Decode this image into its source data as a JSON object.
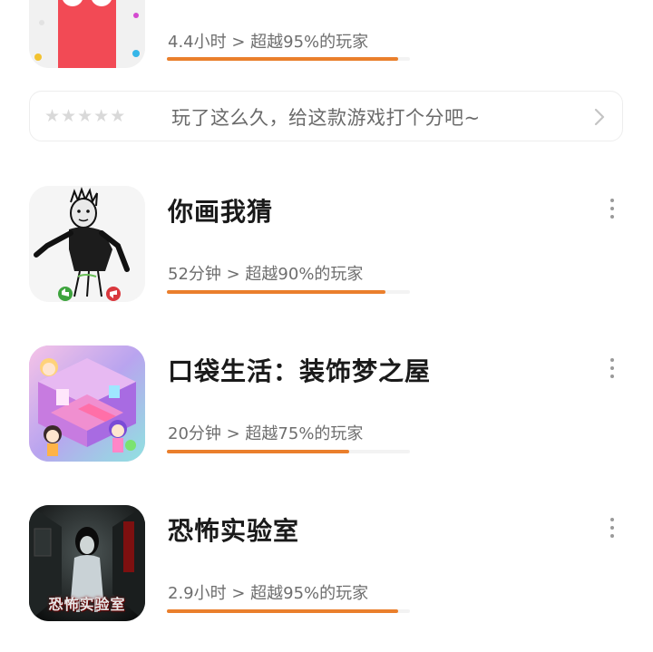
{
  "top_game": {
    "stat_text": "4.4小时 > 超越95%的玩家",
    "progress": 0.95
  },
  "rating_prompt": {
    "stars": 5,
    "text": "玩了这么久，给这款游戏打个分吧~"
  },
  "games": [
    {
      "title": "你画我猜",
      "stat_text": "52分钟 > 超越90%的玩家",
      "progress": 0.9
    },
    {
      "title": "口袋生活：装饰梦之屋",
      "stat_text": "20分钟 > 超越75%的玩家",
      "progress": 0.75
    },
    {
      "title": "恐怖实验室",
      "stat_text": "2.9小时 > 超越95%的玩家",
      "progress": 0.95
    }
  ],
  "colors": {
    "accent": "#ea7f2c",
    "track": "#f3f3f3",
    "title": "#1a1a1a",
    "muted": "#6e6e6e"
  },
  "icons": {
    "more": "vertical-ellipsis-icon",
    "chevron": "chevron-right-icon",
    "star": "star-icon"
  }
}
